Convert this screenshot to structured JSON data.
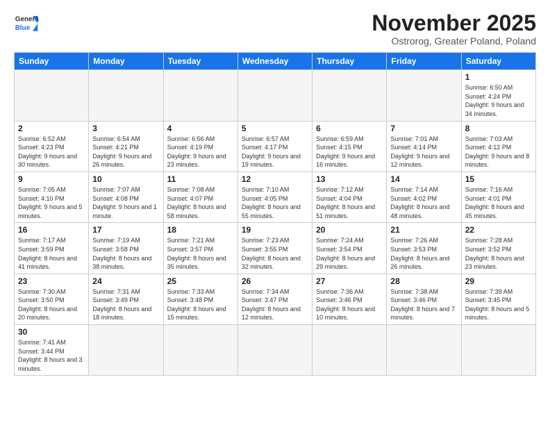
{
  "logo": {
    "line1": "General",
    "line2": "Blue"
  },
  "title": "November 2025",
  "subtitle": "Ostrorog, Greater Poland, Poland",
  "weekdays": [
    "Sunday",
    "Monday",
    "Tuesday",
    "Wednesday",
    "Thursday",
    "Friday",
    "Saturday"
  ],
  "weeks": [
    [
      {
        "day": "",
        "info": ""
      },
      {
        "day": "",
        "info": ""
      },
      {
        "day": "",
        "info": ""
      },
      {
        "day": "",
        "info": ""
      },
      {
        "day": "",
        "info": ""
      },
      {
        "day": "",
        "info": ""
      },
      {
        "day": "1",
        "info": "Sunrise: 6:50 AM\nSunset: 4:24 PM\nDaylight: 9 hours\nand 34 minutes."
      }
    ],
    [
      {
        "day": "2",
        "info": "Sunrise: 6:52 AM\nSunset: 4:23 PM\nDaylight: 9 hours\nand 30 minutes."
      },
      {
        "day": "3",
        "info": "Sunrise: 6:54 AM\nSunset: 4:21 PM\nDaylight: 9 hours\nand 26 minutes."
      },
      {
        "day": "4",
        "info": "Sunrise: 6:56 AM\nSunset: 4:19 PM\nDaylight: 9 hours\nand 23 minutes."
      },
      {
        "day": "5",
        "info": "Sunrise: 6:57 AM\nSunset: 4:17 PM\nDaylight: 9 hours\nand 19 minutes."
      },
      {
        "day": "6",
        "info": "Sunrise: 6:59 AM\nSunset: 4:15 PM\nDaylight: 9 hours\nand 16 minutes."
      },
      {
        "day": "7",
        "info": "Sunrise: 7:01 AM\nSunset: 4:14 PM\nDaylight: 9 hours\nand 12 minutes."
      },
      {
        "day": "8",
        "info": "Sunrise: 7:03 AM\nSunset: 4:12 PM\nDaylight: 9 hours\nand 8 minutes."
      }
    ],
    [
      {
        "day": "9",
        "info": "Sunrise: 7:05 AM\nSunset: 4:10 PM\nDaylight: 9 hours\nand 5 minutes."
      },
      {
        "day": "10",
        "info": "Sunrise: 7:07 AM\nSunset: 4:08 PM\nDaylight: 9 hours\nand 1 minute."
      },
      {
        "day": "11",
        "info": "Sunrise: 7:08 AM\nSunset: 4:07 PM\nDaylight: 8 hours\nand 58 minutes."
      },
      {
        "day": "12",
        "info": "Sunrise: 7:10 AM\nSunset: 4:05 PM\nDaylight: 8 hours\nand 55 minutes."
      },
      {
        "day": "13",
        "info": "Sunrise: 7:12 AM\nSunset: 4:04 PM\nDaylight: 8 hours\nand 51 minutes."
      },
      {
        "day": "14",
        "info": "Sunrise: 7:14 AM\nSunset: 4:02 PM\nDaylight: 8 hours\nand 48 minutes."
      },
      {
        "day": "15",
        "info": "Sunrise: 7:16 AM\nSunset: 4:01 PM\nDaylight: 8 hours\nand 45 minutes."
      }
    ],
    [
      {
        "day": "16",
        "info": "Sunrise: 7:17 AM\nSunset: 3:59 PM\nDaylight: 8 hours\nand 41 minutes."
      },
      {
        "day": "17",
        "info": "Sunrise: 7:19 AM\nSunset: 3:58 PM\nDaylight: 8 hours\nand 38 minutes."
      },
      {
        "day": "18",
        "info": "Sunrise: 7:21 AM\nSunset: 3:57 PM\nDaylight: 8 hours\nand 35 minutes."
      },
      {
        "day": "19",
        "info": "Sunrise: 7:23 AM\nSunset: 3:55 PM\nDaylight: 8 hours\nand 32 minutes."
      },
      {
        "day": "20",
        "info": "Sunrise: 7:24 AM\nSunset: 3:54 PM\nDaylight: 8 hours\nand 29 minutes."
      },
      {
        "day": "21",
        "info": "Sunrise: 7:26 AM\nSunset: 3:53 PM\nDaylight: 8 hours\nand 26 minutes."
      },
      {
        "day": "22",
        "info": "Sunrise: 7:28 AM\nSunset: 3:52 PM\nDaylight: 8 hours\nand 23 minutes."
      }
    ],
    [
      {
        "day": "23",
        "info": "Sunrise: 7:30 AM\nSunset: 3:50 PM\nDaylight: 8 hours\nand 20 minutes."
      },
      {
        "day": "24",
        "info": "Sunrise: 7:31 AM\nSunset: 3:49 PM\nDaylight: 8 hours\nand 18 minutes."
      },
      {
        "day": "25",
        "info": "Sunrise: 7:33 AM\nSunset: 3:48 PM\nDaylight: 8 hours\nand 15 minutes."
      },
      {
        "day": "26",
        "info": "Sunrise: 7:34 AM\nSunset: 3:47 PM\nDaylight: 8 hours\nand 12 minutes."
      },
      {
        "day": "27",
        "info": "Sunrise: 7:36 AM\nSunset: 3:46 PM\nDaylight: 8 hours\nand 10 minutes."
      },
      {
        "day": "28",
        "info": "Sunrise: 7:38 AM\nSunset: 3:46 PM\nDaylight: 8 hours\nand 7 minutes."
      },
      {
        "day": "29",
        "info": "Sunrise: 7:39 AM\nSunset: 3:45 PM\nDaylight: 8 hours\nand 5 minutes."
      }
    ],
    [
      {
        "day": "30",
        "info": "Sunrise: 7:41 AM\nSunset: 3:44 PM\nDaylight: 8 hours\nand 3 minutes."
      },
      {
        "day": "",
        "info": ""
      },
      {
        "day": "",
        "info": ""
      },
      {
        "day": "",
        "info": ""
      },
      {
        "day": "",
        "info": ""
      },
      {
        "day": "",
        "info": ""
      },
      {
        "day": "",
        "info": ""
      }
    ]
  ]
}
